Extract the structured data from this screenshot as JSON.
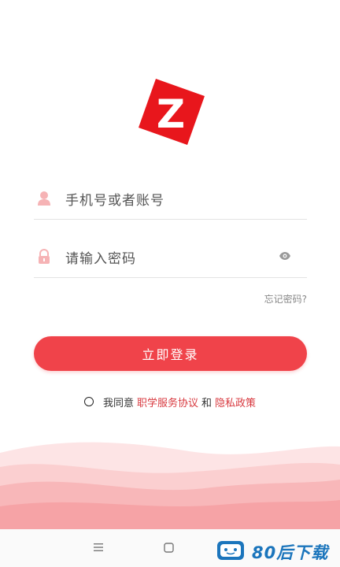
{
  "logo": {
    "letter": "Z",
    "color": "#e8161c"
  },
  "login_form": {
    "account_placeholder": "手机号或者账号",
    "password_placeholder": "请输入密码",
    "forgot_password": "忘记密码?",
    "login_button": "立即登录"
  },
  "agreement": {
    "prefix": "我同意",
    "service_link": "职学服务协议",
    "conjunction": "和",
    "privacy_link": "隐私政策",
    "checked": false
  },
  "icons": {
    "account": "user-icon",
    "password": "lock-icon",
    "show_password": "eye-icon",
    "nav_menu": "menu-icon",
    "nav_home": "home-square-icon"
  },
  "watermark": {
    "text": "80后下载"
  },
  "colors": {
    "accent": "#f0434a",
    "link": "#d8393f",
    "wave": "#f8b7b9"
  }
}
